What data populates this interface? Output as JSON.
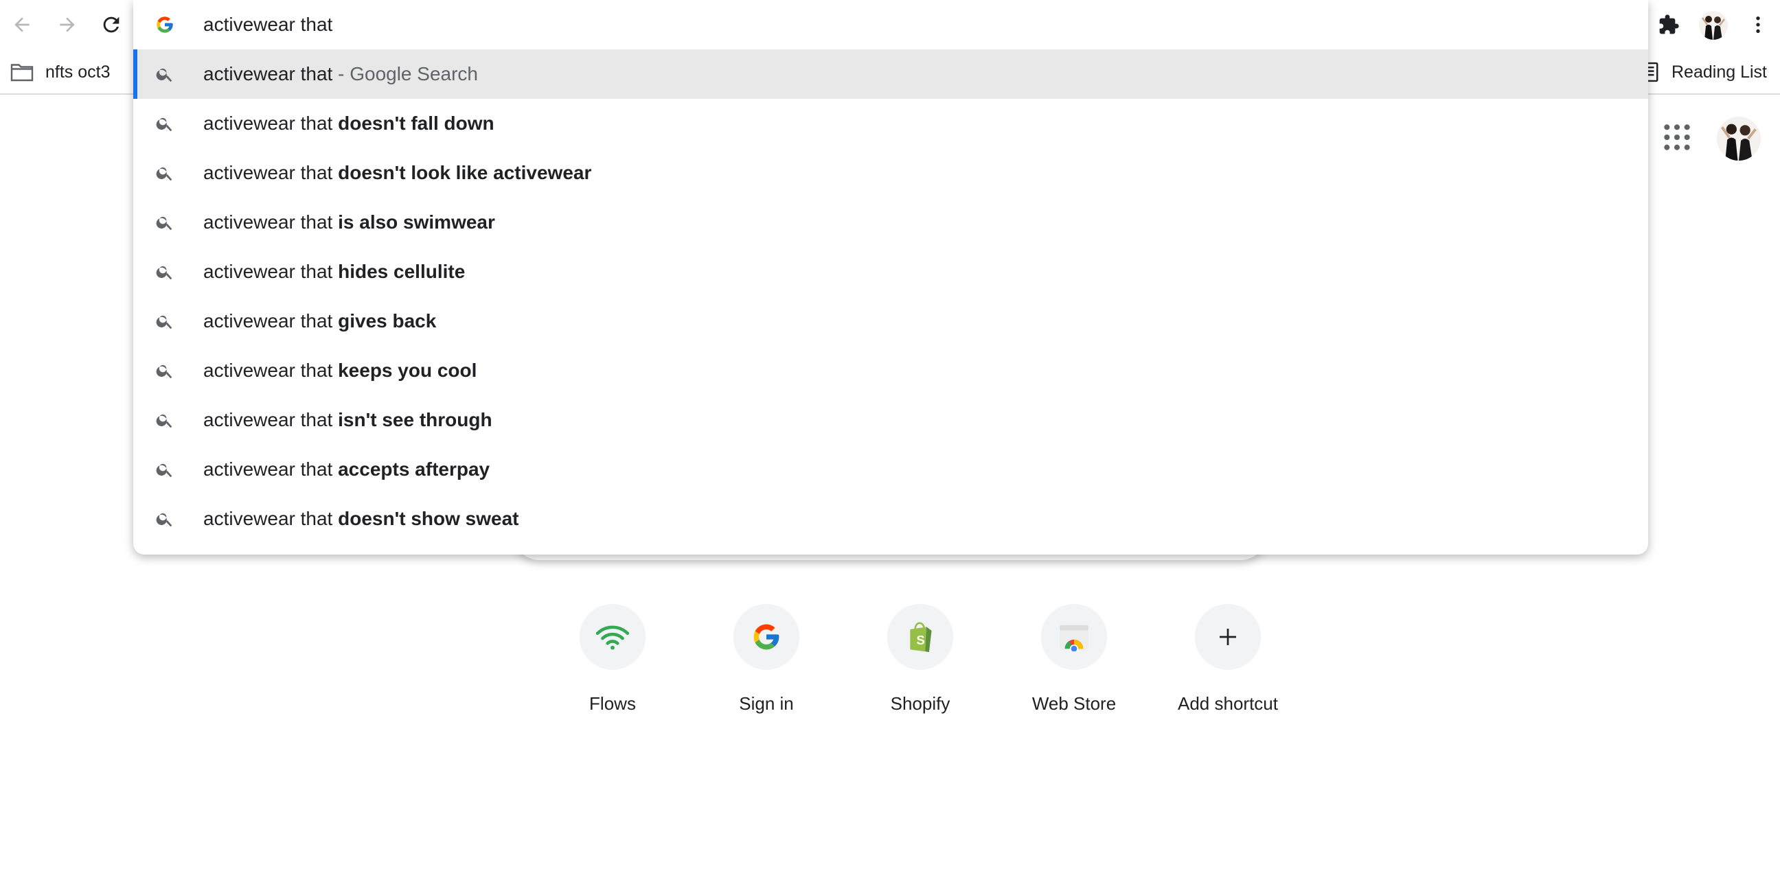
{
  "toolbar": {
    "back_icon": "arrow-left-icon",
    "forward_icon": "arrow-right-icon",
    "reload_icon": "reload-icon",
    "extensions_icon": "puzzle-icon",
    "menu_icon": "kebab-menu-icon"
  },
  "bookmarks": {
    "folder_label": "nfts oct3",
    "reading_list_label": "Reading List"
  },
  "omnibox": {
    "value": "activewear that",
    "selected_prefix": "activewear that",
    "selected_suffix": " - Google Search",
    "suggestions": [
      {
        "prefix": "activewear that ",
        "completion": "doesn't fall down"
      },
      {
        "prefix": "activewear that ",
        "completion": "doesn't look like activewear"
      },
      {
        "prefix": "activewear that ",
        "completion": "is also swimwear"
      },
      {
        "prefix": "activewear that ",
        "completion": "hides cellulite"
      },
      {
        "prefix": "activewear that ",
        "completion": "gives back"
      },
      {
        "prefix": "activewear that ",
        "completion": "keeps you cool"
      },
      {
        "prefix": "activewear that ",
        "completion": "isn't see through"
      },
      {
        "prefix": "activewear that ",
        "completion": "accepts afterpay"
      },
      {
        "prefix": "activewear that ",
        "completion": "doesn't show sweat"
      }
    ]
  },
  "shortcuts": [
    {
      "label": "Flows",
      "icon": "wifi-icon"
    },
    {
      "label": "Sign in",
      "icon": "google-icon"
    },
    {
      "label": "Shopify",
      "icon": "shopify-bag-icon"
    },
    {
      "label": "Web Store",
      "icon": "web-store-icon"
    },
    {
      "label": "Add shortcut",
      "icon": "plus-icon"
    }
  ],
  "colors": {
    "selected_bar": "#1a73e8",
    "selected_bg": "#e8e8e9",
    "shortcut_tile": "#f1f3f4"
  }
}
